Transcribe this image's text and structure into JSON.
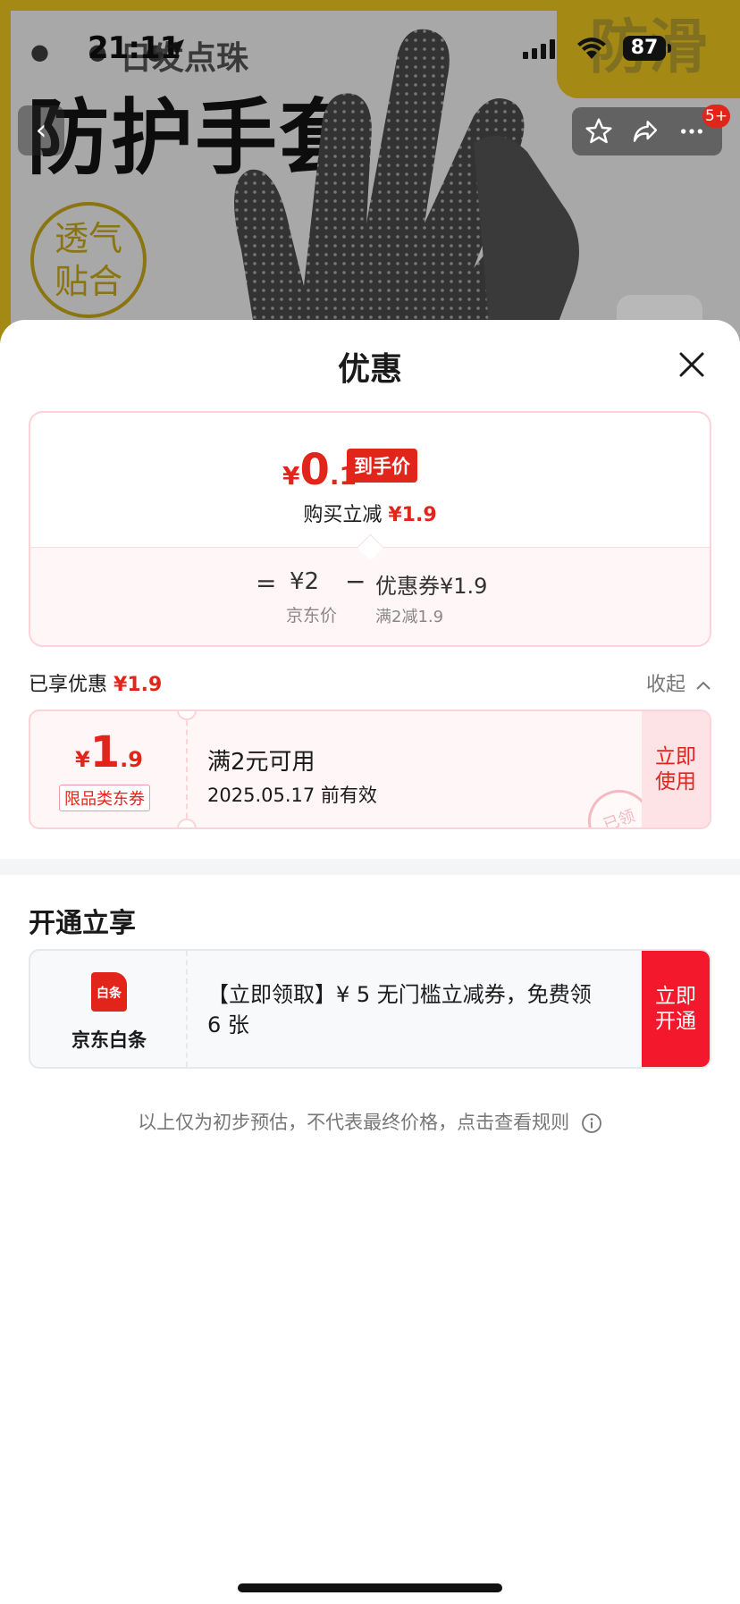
{
  "status_bar": {
    "time": "21:11",
    "battery": "87"
  },
  "background": {
    "subtitle": "日发点珠",
    "title": "防护手套",
    "badge_line1": "透气",
    "badge_line2": "贴合",
    "corner_text": "防滑",
    "notification_badge": "5+"
  },
  "sheet": {
    "title": "优惠",
    "price_summary": {
      "currency": "¥",
      "final_int": "0",
      "final_dec": ".1",
      "tag": "到手价",
      "reduce_label": "购买立减",
      "reduce_amount": "¥1.9",
      "equals": "=",
      "jd_price": "¥2",
      "jd_price_label": "京东价",
      "minus": "−",
      "coupon_text": "优惠券¥1.9",
      "coupon_condition": "满2减1.9"
    },
    "enjoyed": {
      "label": "已享优惠",
      "amount": "¥1.9",
      "collapse_label": "收起"
    },
    "coupon": {
      "currency": "¥",
      "amount_int": "1",
      "amount_dec": ".9",
      "type": "限品类东券",
      "condition": "满2元可用",
      "valid_until": "2025.05.17 前有效",
      "action": "立即使用",
      "stamp": "已领"
    },
    "section_title": "开通立享",
    "baitiao": {
      "logo_text": "白条",
      "name": "京东白条",
      "description": "【立即领取】¥ 5 无门槛立减券，免费领 6 张",
      "action": "立即开通"
    },
    "disclaimer": "以上仅为初步预估，不代表最终价格，点击查看规则"
  },
  "colors": {
    "accent": "#e1251b",
    "coupon_bg": "#fff6f7",
    "coupon_border": "#fbd3d8"
  }
}
